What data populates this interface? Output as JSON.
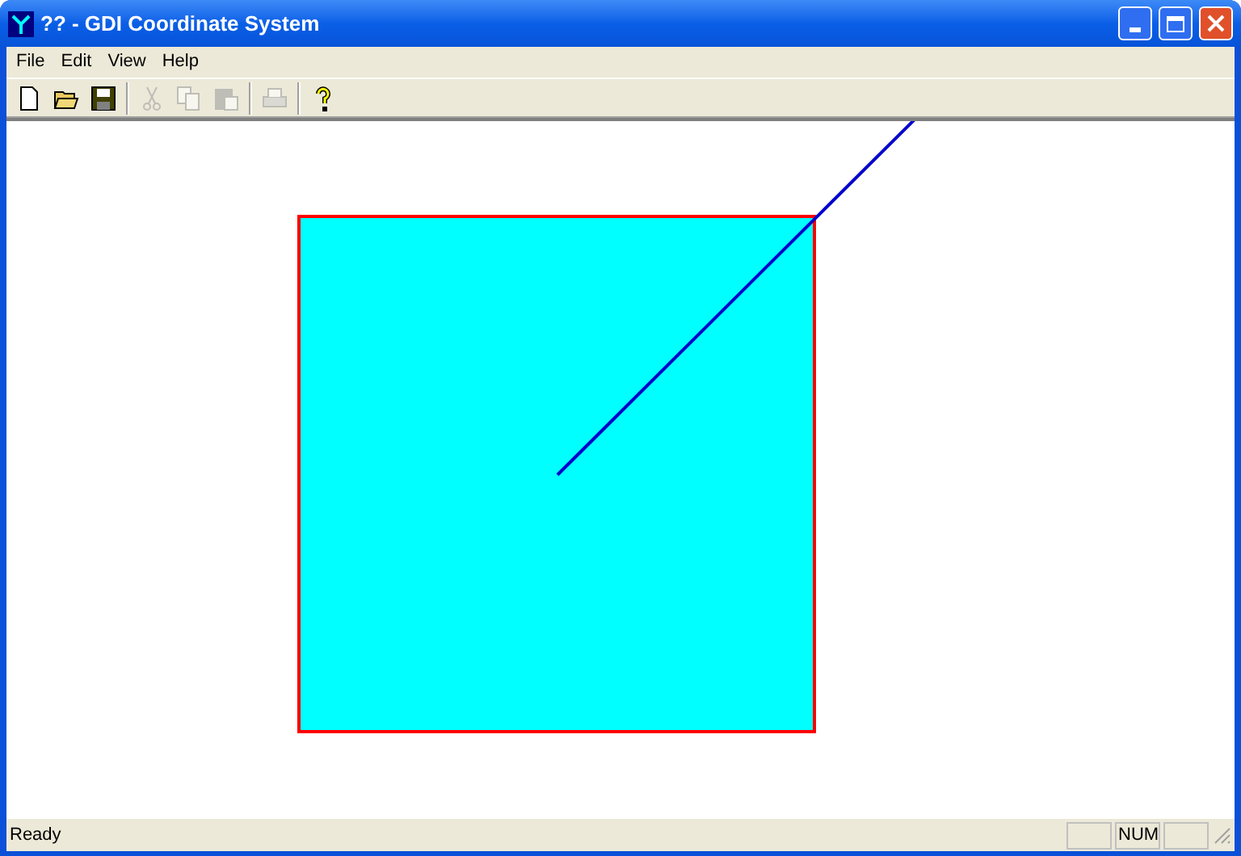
{
  "window": {
    "title": "?? - GDI Coordinate System"
  },
  "menu": [
    "File",
    "Edit",
    "View",
    "Help"
  ],
  "toolbar": [
    {
      "kind": "new",
      "disabled": false
    },
    {
      "kind": "open",
      "disabled": false
    },
    {
      "kind": "save",
      "disabled": false
    },
    {
      "kind": "separator"
    },
    {
      "kind": "cut",
      "disabled": true
    },
    {
      "kind": "copy",
      "disabled": true
    },
    {
      "kind": "paste",
      "disabled": true
    },
    {
      "kind": "separator"
    },
    {
      "kind": "print",
      "disabled": true
    },
    {
      "kind": "separator"
    },
    {
      "kind": "help",
      "disabled": false
    }
  ],
  "status_bar": {
    "message": "Ready",
    "indicators": [
      {
        "kind": "pane"
      },
      {
        "kind": "pane",
        "label": "NUM"
      },
      {
        "kind": "pane"
      }
    ]
  }
}
